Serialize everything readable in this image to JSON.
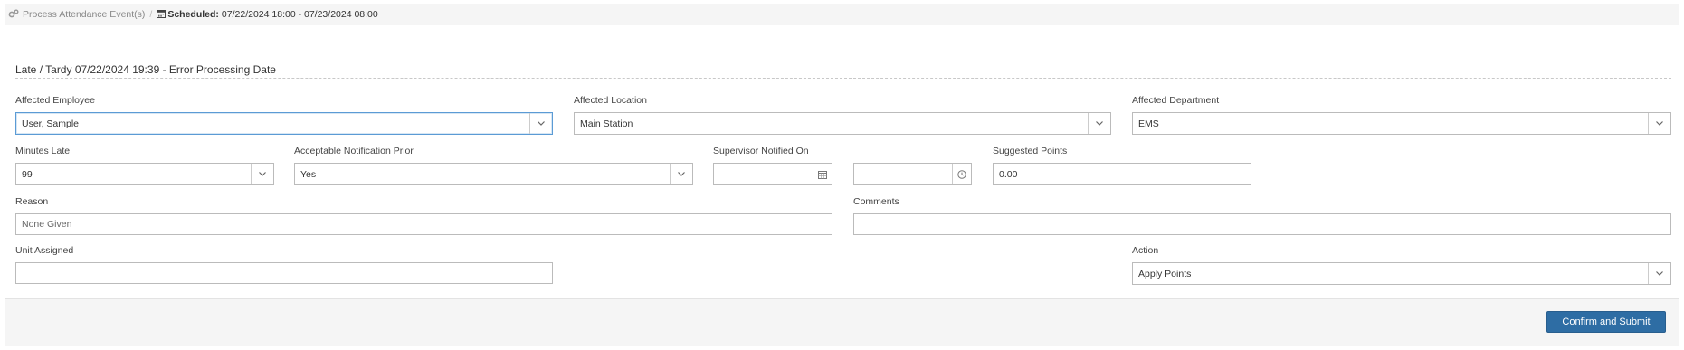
{
  "breadcrumb": {
    "process_label": "Process Attendance Event(s)",
    "separator": "/",
    "scheduled_label": "Scheduled:",
    "scheduled_range": "07/22/2024 18:00 - 07/23/2024 08:00"
  },
  "section": {
    "title": "Late / Tardy 07/22/2024 19:39 - Error Processing Date"
  },
  "form": {
    "affected_employee": {
      "label": "Affected Employee",
      "value": "User, Sample"
    },
    "affected_location": {
      "label": "Affected Location",
      "value": "Main Station"
    },
    "affected_department": {
      "label": "Affected Department",
      "value": "EMS"
    },
    "minutes_late": {
      "label": "Minutes Late",
      "value": "99"
    },
    "acceptable_notification": {
      "label": "Acceptable Notification Prior",
      "value": "Yes"
    },
    "supervisor_notified": {
      "label": "Supervisor Notified On",
      "date_value": "",
      "time_value": ""
    },
    "suggested_points": {
      "label": "Suggested Points",
      "value": "0.00"
    },
    "reason": {
      "label": "Reason",
      "value": "None Given"
    },
    "comments": {
      "label": "Comments",
      "value": ""
    },
    "unit_assigned": {
      "label": "Unit Assigned",
      "value": ""
    },
    "action": {
      "label": "Action",
      "value": "Apply Points"
    }
  },
  "footer": {
    "submit_label": "Confirm and Submit"
  },
  "icons": {
    "process": "gears-icon",
    "calendar": "calendar-icon",
    "clock": "clock-icon",
    "dropdown": "chevron-down-icon"
  },
  "colors": {
    "primary_button": "#2e6da4",
    "focus_border": "#5b9bd5",
    "panel_bg": "#f5f5f5"
  }
}
